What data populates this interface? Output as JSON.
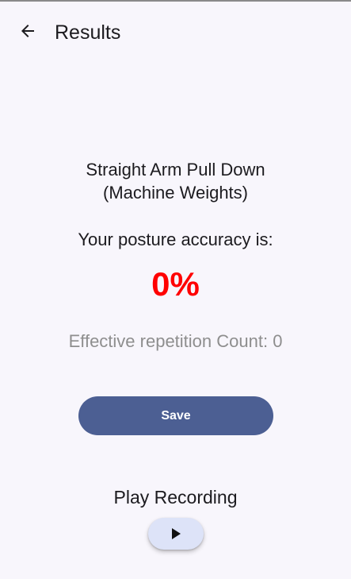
{
  "app_bar": {
    "back_icon": "arrow-left-icon",
    "title": "Results"
  },
  "result": {
    "exercise_line1": "Straight Arm Pull Down",
    "exercise_line2": "(Machine Weights)",
    "accuracy_label": "Your posture accuracy is:",
    "accuracy_value": "0%",
    "accuracy_color": "#ff0000",
    "rep_count_text": "Effective repetition Count: 0"
  },
  "actions": {
    "save_label": "Save",
    "play_recording_label": "Play Recording",
    "play_icon": "play-icon"
  },
  "colors": {
    "background": "#f8f6fc",
    "save_button": "#4c5f93",
    "play_button": "#dde3f8"
  }
}
